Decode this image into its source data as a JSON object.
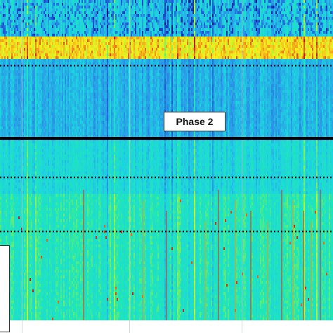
{
  "chart_data": {
    "type": "heatmap",
    "title": "",
    "xlabel": "",
    "ylabel": "",
    "colormap": [
      "#0a1a8c",
      "#1f5cd6",
      "#2a9be8",
      "#1ed4e0",
      "#1fe6b8",
      "#9ef23a",
      "#f5f01e",
      "#f28a1a",
      "#b81a1a"
    ],
    "annotations": [
      {
        "text": "Phase 2"
      }
    ],
    "phase_boundary_line": {
      "style": "solid",
      "color": "#000000",
      "y_fraction_of_depth": 0.432
    },
    "dotted_boundary_lines": [
      {
        "style": "dotted",
        "color": "#000000",
        "y_fraction_of_depth": 0.205
      },
      {
        "style": "dotted",
        "color": "#000000",
        "y_fraction_of_depth": 0.553
      },
      {
        "style": "dotted",
        "color": "#000000",
        "y_fraction_of_depth": 0.722
      }
    ],
    "vertical_reference_lines": [
      0.065,
      0.388,
      0.725
    ],
    "bands": [
      {
        "name": "",
        "depth_range": [
          0.0,
          0.11
        ],
        "level": 0.35
      },
      {
        "name": "",
        "depth_range": [
          0.11,
          0.18
        ],
        "level": 0.75
      },
      {
        "name": "",
        "depth_range": [
          0.18,
          0.43
        ],
        "level": 0.3
      },
      {
        "name": "",
        "depth_range": [
          0.43,
          0.6
        ],
        "level": 0.4
      },
      {
        "name": "",
        "depth_range": [
          0.6,
          1.0
        ],
        "level": 0.48
      }
    ]
  },
  "annotation": {
    "phase_label": "Phase 2"
  }
}
